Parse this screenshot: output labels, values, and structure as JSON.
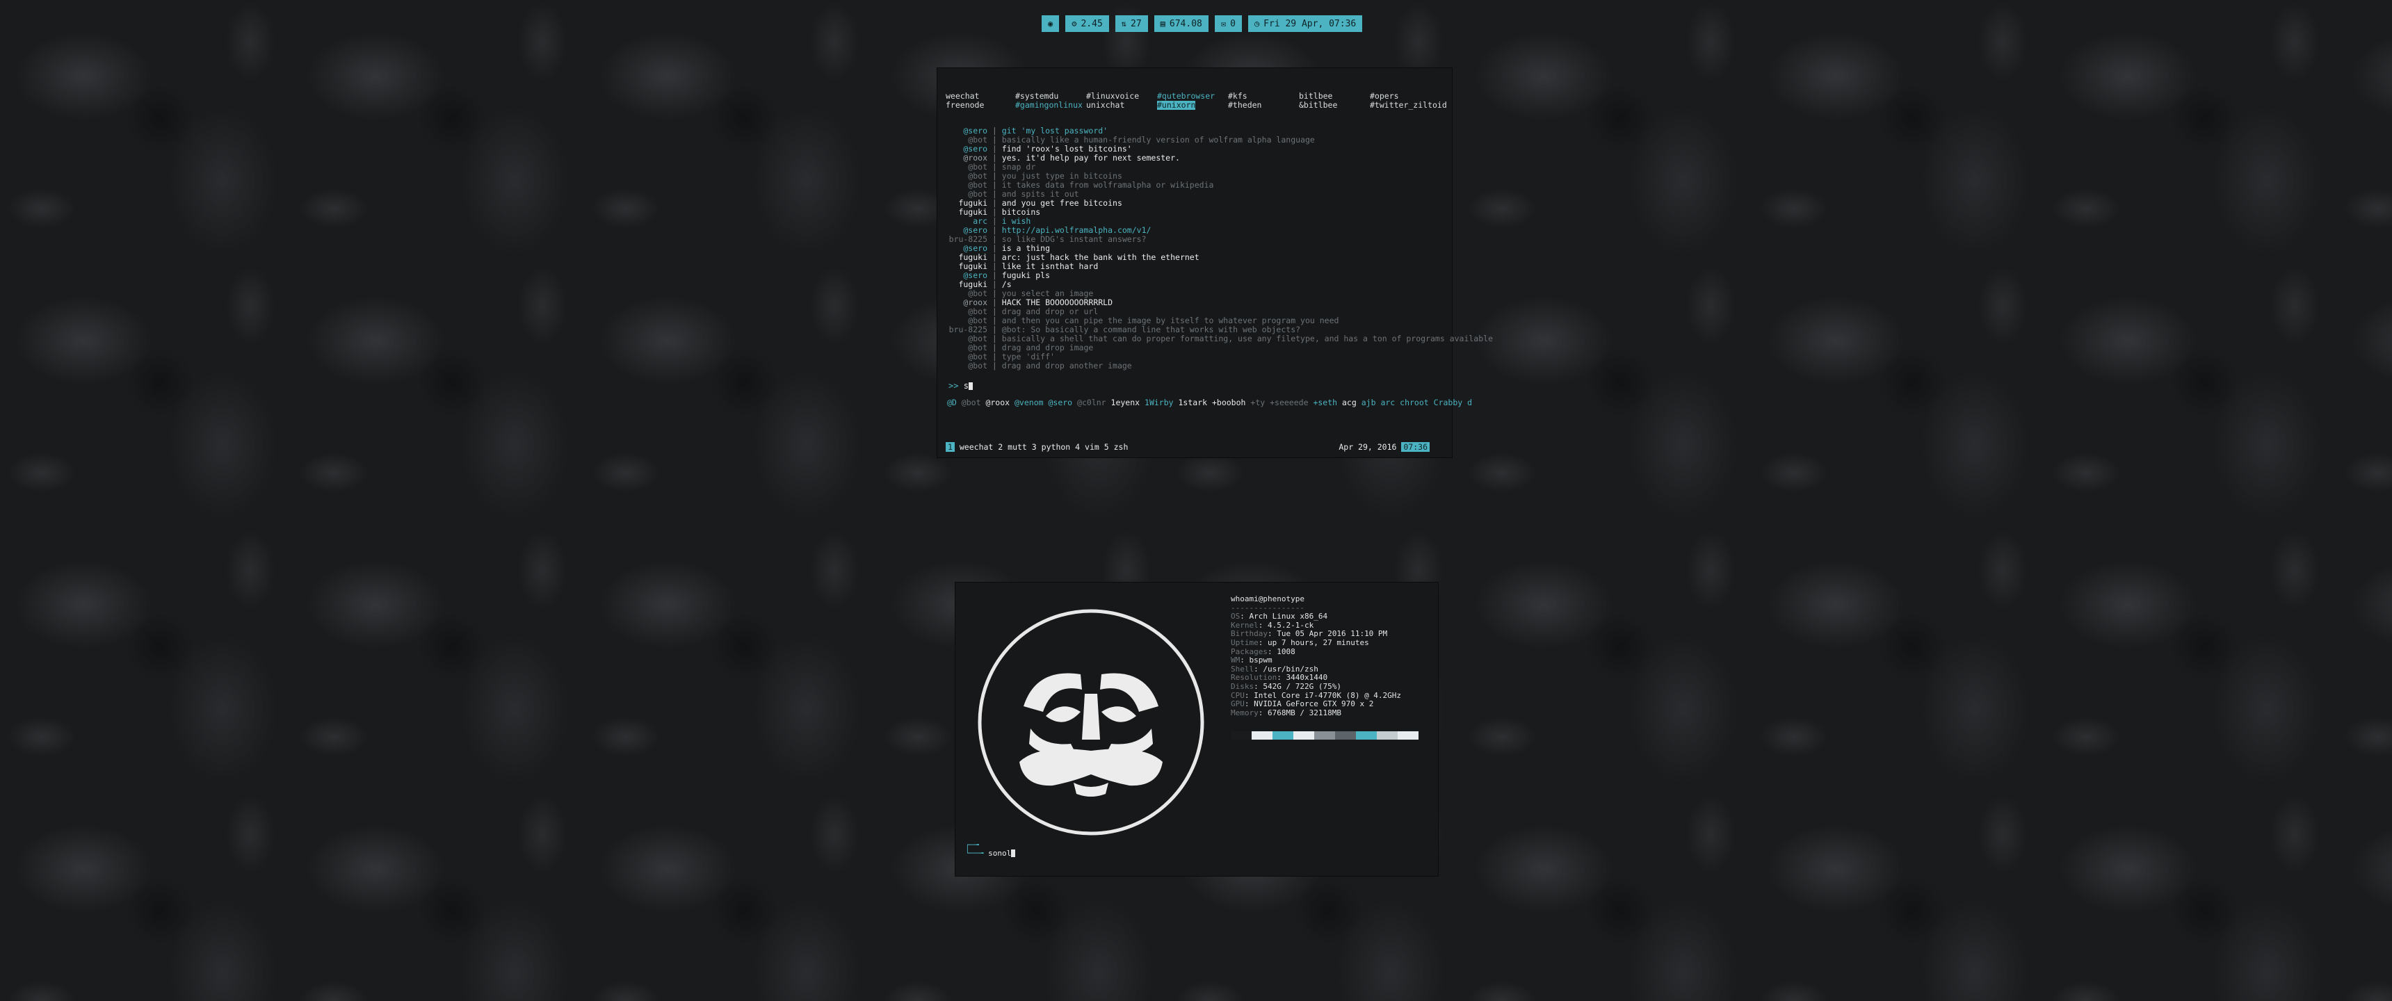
{
  "statusbar": [
    {
      "icon": "◉",
      "icon_name": "system-icon",
      "text": ""
    },
    {
      "icon": "⚙",
      "icon_name": "cpu-load-icon",
      "text": "2.45"
    },
    {
      "icon": "⇅",
      "icon_name": "network-icon",
      "text": "27"
    },
    {
      "icon": "▤",
      "icon_name": "disk-icon",
      "text": "674.08"
    },
    {
      "icon": "✉",
      "icon_name": "mail-icon",
      "text": "0"
    },
    {
      "icon": "◷",
      "icon_name": "clock-icon",
      "text": "Fri 29 Apr, 07:36"
    }
  ],
  "weechat": {
    "channels_row1": [
      {
        "name": "weechat",
        "hl": false
      },
      {
        "name": "#systemdu",
        "hl": false
      },
      {
        "name": "#linuxvoice",
        "hl": false
      },
      {
        "name": "#qutebrowser",
        "hl": "text"
      },
      {
        "name": "#kfs",
        "hl": false
      },
      {
        "name": "bitlbee",
        "hl": false
      },
      {
        "name": "#opers",
        "hl": false
      }
    ],
    "channels_row2": [
      {
        "name": "freenode",
        "hl": false
      },
      {
        "name": "#gamingonlinux",
        "hl": "text"
      },
      {
        "name": "unixchat",
        "hl": false
      },
      {
        "name": "#unixorn",
        "hl": "bg"
      },
      {
        "name": "#theden",
        "hl": false
      },
      {
        "name": "&bitlbee",
        "hl": false
      },
      {
        "name": "#twitter_ziltoid",
        "hl": false
      }
    ],
    "messages": [
      {
        "nick": "@sero",
        "nc": "c-cyan",
        "text": "git 'my lost password'",
        "tc": "c-cyan"
      },
      {
        "nick": "@bot",
        "nc": "c-dim",
        "text": "basically like a human-friendly version of wolfram alpha language",
        "tc": "c-dim"
      },
      {
        "nick": "@sero",
        "nc": "c-cyan",
        "text": "find 'roox's lost bitcoins'",
        "tc": "c-white"
      },
      {
        "nick": "@roox",
        "nc": "c-grey",
        "text": "yes. it'd help pay for next semester.",
        "tc": "c-white"
      },
      {
        "nick": "@bot",
        "nc": "c-dim",
        "text": "snap dr",
        "tc": "c-dim"
      },
      {
        "nick": "@bot",
        "nc": "c-dim",
        "text": "you just type in bitcoins",
        "tc": "c-dim"
      },
      {
        "nick": "@bot",
        "nc": "c-dim",
        "text": "it takes data from wolframalpha or wikipedia",
        "tc": "c-dim"
      },
      {
        "nick": "@bot",
        "nc": "c-dim",
        "text": "and spits it out",
        "tc": "c-dim"
      },
      {
        "nick": "fuguki",
        "nc": "c-white",
        "text": "and you get free bitcoins",
        "tc": "c-white"
      },
      {
        "nick": "fuguki",
        "nc": "c-white",
        "text": "bitcoins",
        "tc": "c-white"
      },
      {
        "nick": "arc",
        "nc": "c-cyan",
        "text": "i wish",
        "tc": "c-cyan"
      },
      {
        "nick": "@sero",
        "nc": "c-cyan",
        "text": "http://api.wolframalpha.com/v1/",
        "tc": "c-cyan"
      },
      {
        "nick": "bru-8225",
        "nc": "c-dim",
        "text": "so like DDG's instant answers?",
        "tc": "c-dim"
      },
      {
        "nick": "@sero",
        "nc": "c-cyan",
        "text": "is a thing",
        "tc": "c-white"
      },
      {
        "nick": "fuguki",
        "nc": "c-white",
        "text": "arc: just hack the bank with the ethernet",
        "tc": "c-white"
      },
      {
        "nick": "fuguki",
        "nc": "c-white",
        "text": "like it isnthat hard",
        "tc": "c-white"
      },
      {
        "nick": "@sero",
        "nc": "c-cyan",
        "text": "fuguki pls",
        "tc": "c-white"
      },
      {
        "nick": "fuguki",
        "nc": "c-white",
        "text": "/s",
        "tc": "c-white"
      },
      {
        "nick": "@bot",
        "nc": "c-dim",
        "text": "you select an image",
        "tc": "c-dim"
      },
      {
        "nick": "@roox",
        "nc": "c-grey",
        "text": "HACK THE BOOOOOOORRRRLD",
        "tc": "c-white"
      },
      {
        "nick": "@bot",
        "nc": "c-dim",
        "text": "drag and drop or url",
        "tc": "c-dim"
      },
      {
        "nick": "@bot",
        "nc": "c-dim",
        "text": "and then you can pipe the image by itself to whatever program you need",
        "tc": "c-dim"
      },
      {
        "nick": "bru-8225",
        "nc": "c-dim",
        "text": "@bot: So basically a command line that works with web objects?",
        "tc": "c-dim"
      },
      {
        "nick": "@bot",
        "nc": "c-dim",
        "text": "basically a shell that can do proper formatting, use any filetype, and has a ton of programs available",
        "tc": "c-dim"
      },
      {
        "nick": "@bot",
        "nc": "c-dim",
        "text": "drag and drop image",
        "tc": "c-dim"
      },
      {
        "nick": "@bot",
        "nc": "c-dim",
        "text": "type 'diff'",
        "tc": "c-dim"
      },
      {
        "nick": "@bot",
        "nc": "c-dim",
        "text": "drag and drop another image",
        "tc": "c-dim"
      }
    ],
    "input_prompt": ">>",
    "input_value": "s",
    "nicklist": [
      {
        "n": "@D",
        "c": "c-cyan"
      },
      {
        "n": "@bot",
        "c": "c-dim"
      },
      {
        "n": "@roox",
        "c": "c-white"
      },
      {
        "n": "@venom",
        "c": "c-cyan"
      },
      {
        "n": "@sero",
        "c": "c-cyan"
      },
      {
        "n": "@c0lnr",
        "c": "c-dim"
      },
      {
        "n": "1eyenx",
        "c": "c-white"
      },
      {
        "n": "1Wirby",
        "c": "c-cyan"
      },
      {
        "n": "1stark",
        "c": "c-white"
      },
      {
        "n": "+booboh",
        "c": "c-white"
      },
      {
        "n": "+ty",
        "c": "c-dim"
      },
      {
        "n": "+seeeede",
        "c": "c-dim"
      },
      {
        "n": "+seth",
        "c": "c-cyan"
      },
      {
        "n": "acg",
        "c": "c-white"
      },
      {
        "n": "ajb",
        "c": "c-cyan"
      },
      {
        "n": "arc",
        "c": "c-cyan"
      },
      {
        "n": "chroot",
        "c": "c-cyan"
      },
      {
        "n": "Crabby",
        "c": "c-cyan"
      },
      {
        "n": "d",
        "c": "c-cyan"
      }
    ],
    "tabs": [
      {
        "num": "1",
        "name": "weechat",
        "active": true
      },
      {
        "num": "2",
        "name": "mutt",
        "active": false
      },
      {
        "num": "3",
        "name": "python",
        "active": false
      },
      {
        "num": "4",
        "name": "vim",
        "active": false
      },
      {
        "num": "5",
        "name": "zsh",
        "active": false
      }
    ],
    "date": "Apr 29, 2016",
    "time": "07:36"
  },
  "sysinfo": {
    "header": "whoami@phenotype",
    "underline": "----------------",
    "rows": [
      {
        "label": "OS",
        "value": "Arch Linux x86_64"
      },
      {
        "label": "Kernel",
        "value": "4.5.2-1-ck"
      },
      {
        "label": "Birthday",
        "value": "Tue 05 Apr 2016 11:10 PM"
      },
      {
        "label": "Uptime",
        "value": "up 7 hours, 27 minutes"
      },
      {
        "label": "Packages",
        "value": "1008"
      },
      {
        "label": "WM",
        "value": "bspwm"
      },
      {
        "label": "Shell",
        "value": "/usr/bin/zsh"
      },
      {
        "label": "Resolution",
        "value": "3440x1440"
      },
      {
        "label": "Disks",
        "value": "542G / 722G (75%)"
      },
      {
        "label": "CPU",
        "value": "Intel Core i7-4770K (8) @ 4.2GHz"
      },
      {
        "label": "GPU",
        "value": "NVIDIA GeForce GTX 970 x 2"
      },
      {
        "label": "Memory",
        "value": "6768MB / 32118MB"
      }
    ],
    "palette": [
      "#1a1b1c",
      "#e8ecee",
      "#4bb3c1",
      "#e8ecee",
      "#8a9196",
      "#5c6469",
      "#4bb3c1",
      "#c4ccd0",
      "#e8ecee"
    ]
  },
  "shell": {
    "line1": "┌─╼",
    "line2": "└──╼",
    "cmd": "sonol"
  }
}
